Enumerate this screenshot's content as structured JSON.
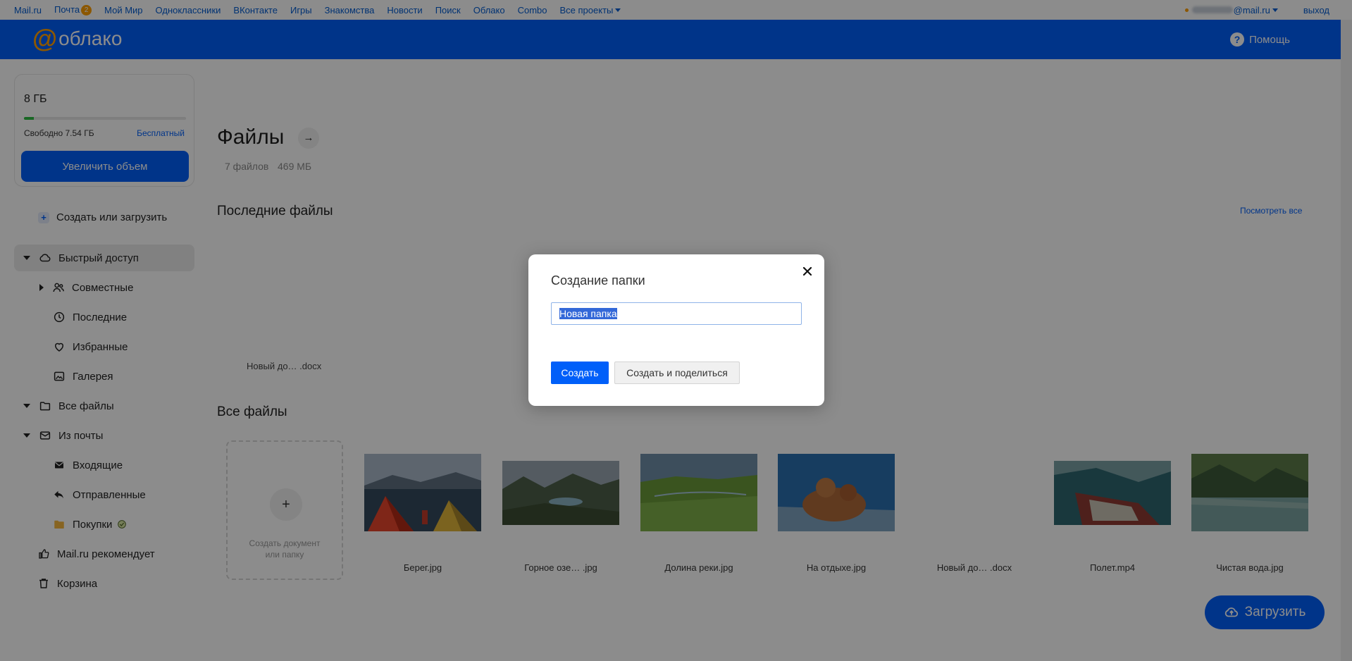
{
  "portal": {
    "links": [
      "Mail.ru",
      "Почта",
      "Мой Мир",
      "Одноклассники",
      "ВКонтакте",
      "Игры",
      "Знакомства",
      "Новости",
      "Поиск",
      "Облако",
      "Combo",
      "Все проекты"
    ],
    "mail_badge": "2",
    "email_domain": "@mail.ru",
    "logout": "выход"
  },
  "header": {
    "logo_text": "облако",
    "help": "Помощь",
    "brand_color": "#005ff9"
  },
  "storage": {
    "total": "8 ГБ",
    "free": "Свободно 7.54 ГБ",
    "plan": "Бесплатный",
    "used_fraction": 0.06,
    "upgrade": "Увеличить объем"
  },
  "sidebar": {
    "create_upload": "Создать или загрузить",
    "items": [
      {
        "label": "Быстрый доступ"
      },
      {
        "label": "Совместные"
      },
      {
        "label": "Последние"
      },
      {
        "label": "Избранные"
      },
      {
        "label": "Галерея"
      },
      {
        "label": "Все файлы"
      },
      {
        "label": "Из почты"
      },
      {
        "label": "Входящие"
      },
      {
        "label": "Отправленные"
      },
      {
        "label": "Покупки"
      },
      {
        "label": "Mail.ru рекомендует"
      },
      {
        "label": "Корзина"
      }
    ]
  },
  "main": {
    "title": "Файлы",
    "file_count": "7 файлов",
    "file_size": "469 МБ",
    "recent_title": "Последние файлы",
    "see_all": "Посмотреть все",
    "recent_file": "Новый до… .docx",
    "all_title": "Все файлы",
    "create_tile": "Создать документ или папку",
    "files": [
      {
        "name": "Берег.jpg"
      },
      {
        "name": "Горное озе… .jpg"
      },
      {
        "name": "Долина реки.jpg"
      },
      {
        "name": "На отдыхе.jpg"
      },
      {
        "name": "Новый до… .docx"
      },
      {
        "name": "Полет.mp4"
      },
      {
        "name": "Чистая вода.jpg"
      }
    ],
    "upload": "Загрузить"
  },
  "dialog": {
    "title": "Создание папки",
    "input_value": "Новая папка",
    "create": "Создать",
    "create_share": "Создать и поделиться"
  }
}
